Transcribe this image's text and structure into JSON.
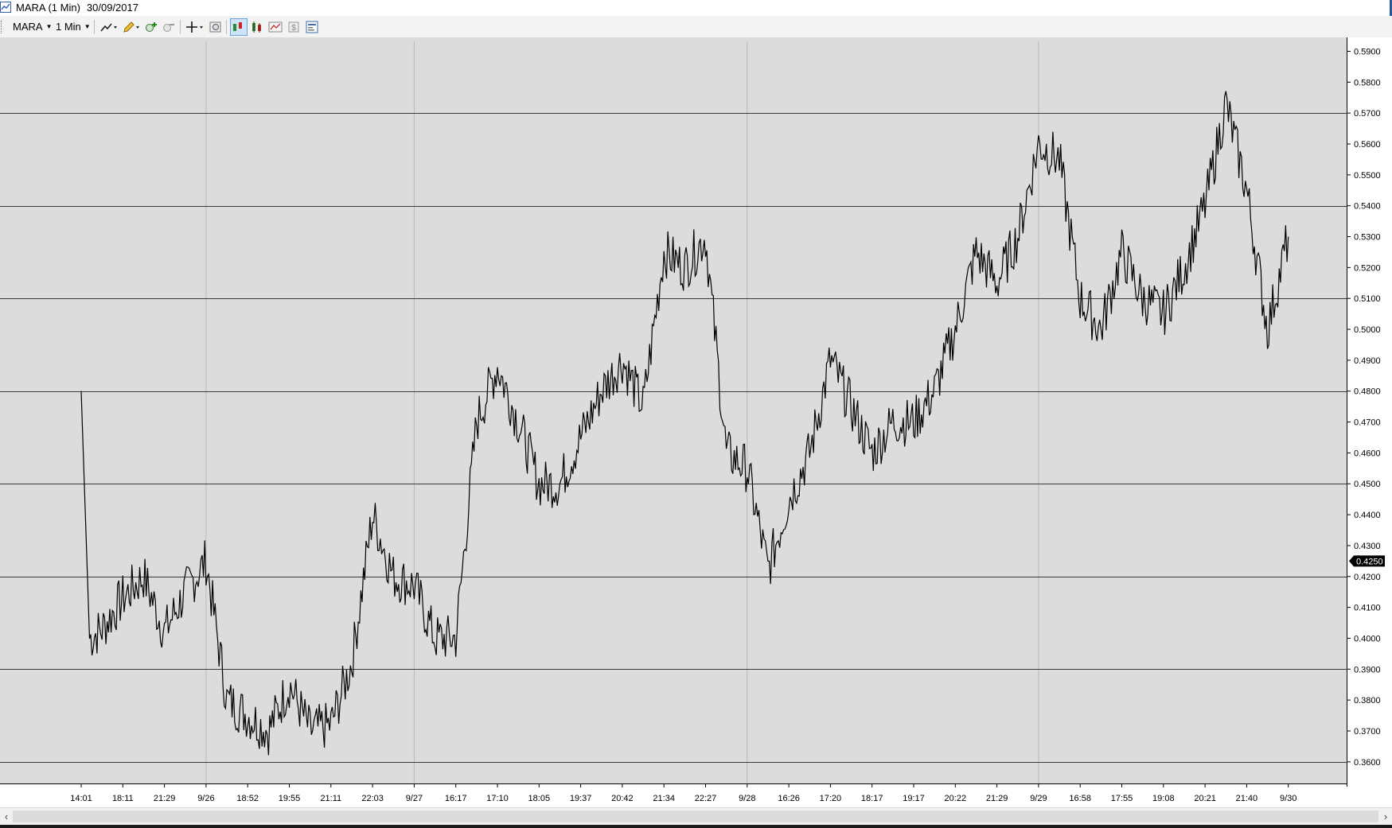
{
  "window": {
    "title": "MARA (1 Min)",
    "date": "30/09/2017"
  },
  "toolbar": {
    "instrument": "MARA",
    "interval": "1 Min",
    "icons": [
      "drawing-tools-icon",
      "pencil-icon",
      "zoom-in-icon",
      "zoom-out-icon",
      "crosshair-icon",
      "magnifier-icon",
      "bar-chart-icon",
      "candlestick-icon",
      "indicator-icon",
      "strategy-icon",
      "properties-icon"
    ]
  },
  "colors": {
    "plot_background": "#dcdcdc",
    "price_line": "#000000",
    "horizontal_line": "#3a3a3a",
    "separator": "#b8b8b8"
  },
  "chart_data": {
    "type": "line",
    "ylim": [
      0.353,
      0.5945
    ],
    "y_ticks": [
      "0.3600",
      "0.3700",
      "0.3800",
      "0.3900",
      "0.4000",
      "0.4100",
      "0.4200",
      "0.4300",
      "0.4400",
      "0.4500",
      "0.4600",
      "0.4700",
      "0.4800",
      "0.4900",
      "0.5000",
      "0.5100",
      "0.5200",
      "0.5300",
      "0.5400",
      "0.5500",
      "0.5600",
      "0.5700",
      "0.5800",
      "0.5900"
    ],
    "x_ticks": [
      "14:01",
      "18:11",
      "21:29",
      "9/26",
      "18:52",
      "19:55",
      "21:11",
      "22:03",
      "9/27",
      "16:17",
      "17:10",
      "18:05",
      "19:37",
      "20:42",
      "21:34",
      "22:27",
      "9/28",
      "16:26",
      "17:20",
      "18:17",
      "19:17",
      "20:22",
      "21:29",
      "9/29",
      "16:58",
      "17:55",
      "19:08",
      "20:21",
      "21:40",
      "9/30"
    ],
    "horizontal_lines": [
      0.36,
      0.39,
      0.42,
      0.45,
      0.48,
      0.51,
      0.54,
      0.57
    ],
    "day_separators_after_label": [
      "9/26",
      "9/27",
      "9/28",
      "9/29"
    ],
    "last_price": "0.4250",
    "series": [
      {
        "x": [
          0,
          0.2,
          0.5,
          1,
          1.5,
          2,
          2.5,
          3,
          3.5,
          4,
          4.5,
          5,
          5.5,
          6,
          6.5,
          7,
          7.5,
          8,
          8.5,
          9,
          9.5,
          10,
          10.5,
          11,
          11.5,
          12,
          12.5,
          13,
          13.5,
          14,
          14.5,
          15,
          15.5,
          16,
          16.5,
          17,
          17.5,
          18,
          18.5,
          19,
          19.5,
          20,
          20.5,
          21,
          21.5,
          22,
          22.5,
          23,
          23.5,
          24,
          24.5,
          25,
          25.5,
          26,
          26.5,
          27,
          27.5,
          28,
          28.5,
          29
        ],
        "y": [
          0.48,
          0.4,
          0.403,
          0.413,
          0.42,
          0.402,
          0.415,
          0.425,
          0.38,
          0.375,
          0.37,
          0.385,
          0.37,
          0.372,
          0.392,
          0.44,
          0.42,
          0.417,
          0.4,
          0.4,
          0.47,
          0.488,
          0.47,
          0.45,
          0.45,
          0.465,
          0.48,
          0.49,
          0.475,
          0.525,
          0.52,
          0.53,
          0.46,
          0.455,
          0.422,
          0.445,
          0.46,
          0.49,
          0.475,
          0.46,
          0.47,
          0.47,
          0.48,
          0.5,
          0.525,
          0.515,
          0.53,
          0.56,
          0.555,
          0.51,
          0.5,
          0.525,
          0.51,
          0.505,
          0.52,
          0.54,
          0.573,
          0.545,
          0.5,
          0.53
        ]
      }
    ]
  }
}
